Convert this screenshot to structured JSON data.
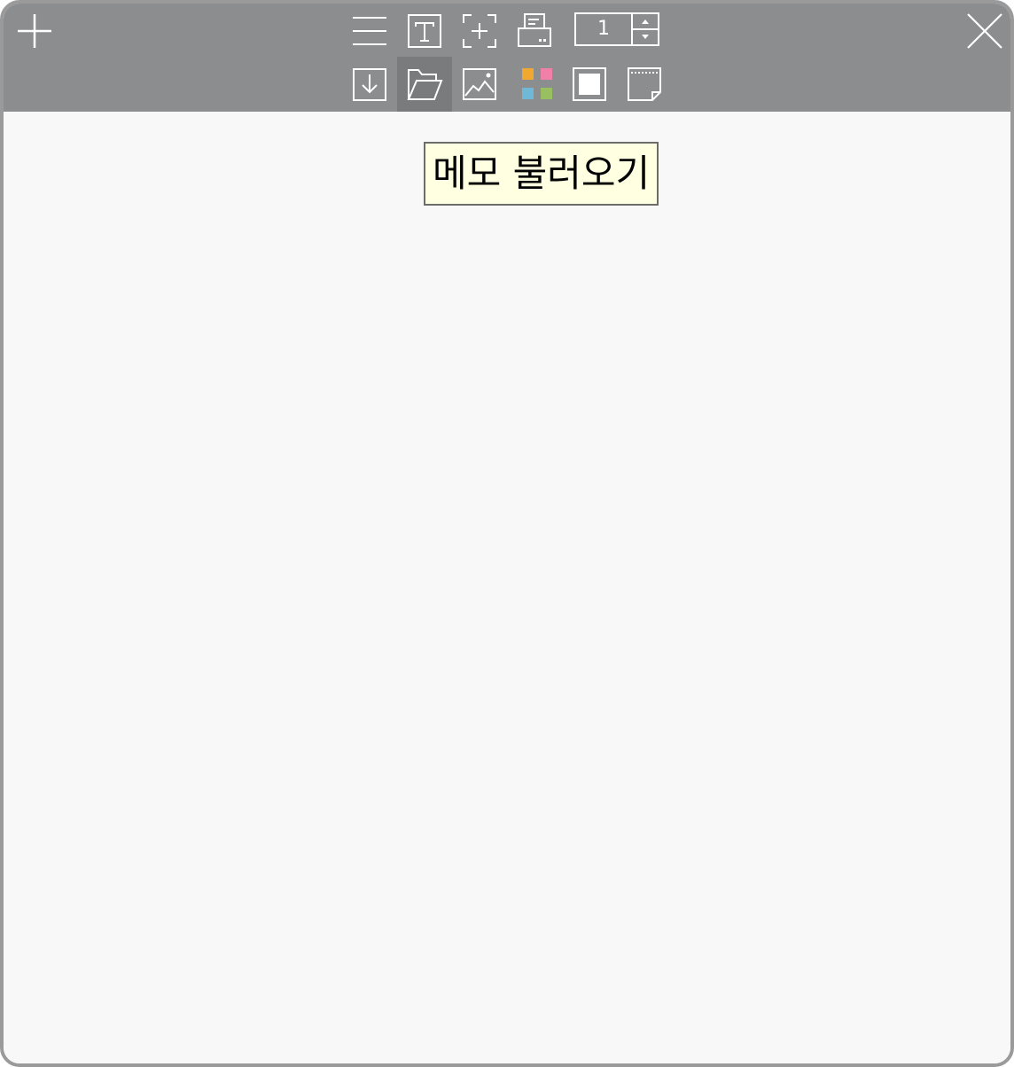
{
  "toolbar": {
    "row1": [
      {
        "icon": "plus-icon",
        "name": "new-memo"
      },
      {
        "icon": "menu-icon",
        "name": "menu"
      },
      {
        "icon": "text-icon",
        "name": "text"
      },
      {
        "icon": "capture-icon",
        "name": "capture"
      },
      {
        "icon": "print-icon",
        "name": "print"
      },
      {
        "icon": "close-icon",
        "name": "close"
      }
    ],
    "row2": [
      {
        "icon": "save-icon",
        "name": "save"
      },
      {
        "icon": "folder-open-icon",
        "name": "open-memo",
        "active": true
      },
      {
        "icon": "image-icon",
        "name": "image"
      },
      {
        "icon": "color-palette-icon",
        "name": "color"
      },
      {
        "icon": "background-icon",
        "name": "background"
      },
      {
        "icon": "memo-paper-icon",
        "name": "memo-paper"
      }
    ],
    "page_spinner": {
      "value": "1"
    }
  },
  "colors": {
    "toolbar_bg": "#8c8d8f",
    "content_bg": "#f8f8f8",
    "tooltip_bg": "#ffffe1",
    "palette": [
      "#f0a830",
      "#f080a8",
      "#70b8d8",
      "#98c060"
    ]
  },
  "tooltip": {
    "text": "메모 불러오기"
  }
}
